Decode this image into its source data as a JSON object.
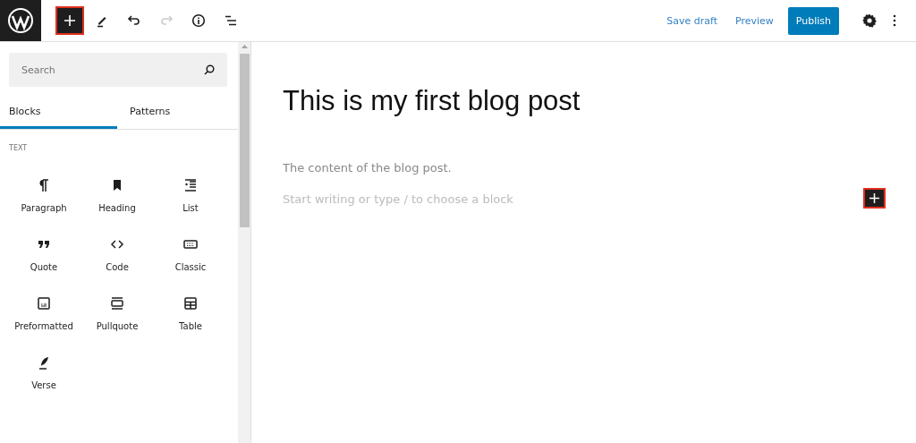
{
  "toolbar": {
    "tools": [
      {
        "kind": "inserter",
        "active": true,
        "disabled": false
      },
      {
        "kind": "pen",
        "active": false,
        "disabled": false
      },
      {
        "kind": "undo",
        "active": false,
        "disabled": false
      },
      {
        "kind": "redo",
        "active": false,
        "disabled": true
      },
      {
        "kind": "info",
        "active": false,
        "disabled": false
      },
      {
        "kind": "outline",
        "active": false,
        "disabled": false
      }
    ],
    "actions": [
      {
        "kind": "link",
        "label": "Save draft"
      },
      {
        "kind": "link",
        "label": "Preview"
      },
      {
        "kind": "primary",
        "label": "Publish"
      }
    ]
  },
  "sidebar": {
    "search": {
      "placeholder": "Search"
    },
    "tabs": [
      {
        "label": "Blocks",
        "selected": true
      },
      {
        "label": "Patterns",
        "selected": false
      }
    ],
    "section": "TEXT",
    "blocks": [
      {
        "kind": "paragraph",
        "label": "Paragraph"
      },
      {
        "kind": "heading",
        "label": "Heading"
      },
      {
        "kind": "list",
        "label": "List"
      },
      {
        "kind": "quote",
        "label": "Quote"
      },
      {
        "kind": "code",
        "label": "Code"
      },
      {
        "kind": "classic",
        "label": "Classic"
      },
      {
        "kind": "preformatted",
        "label": "Preformatted"
      },
      {
        "kind": "pullquote",
        "label": "Pullquote"
      },
      {
        "kind": "table",
        "label": "Table"
      },
      {
        "kind": "verse",
        "label": "Verse"
      }
    ]
  },
  "editor": {
    "title": "This is my first blog post",
    "paragraph": "The content of the blog post.",
    "placeholder": "Start writing or type / to choose a block"
  }
}
